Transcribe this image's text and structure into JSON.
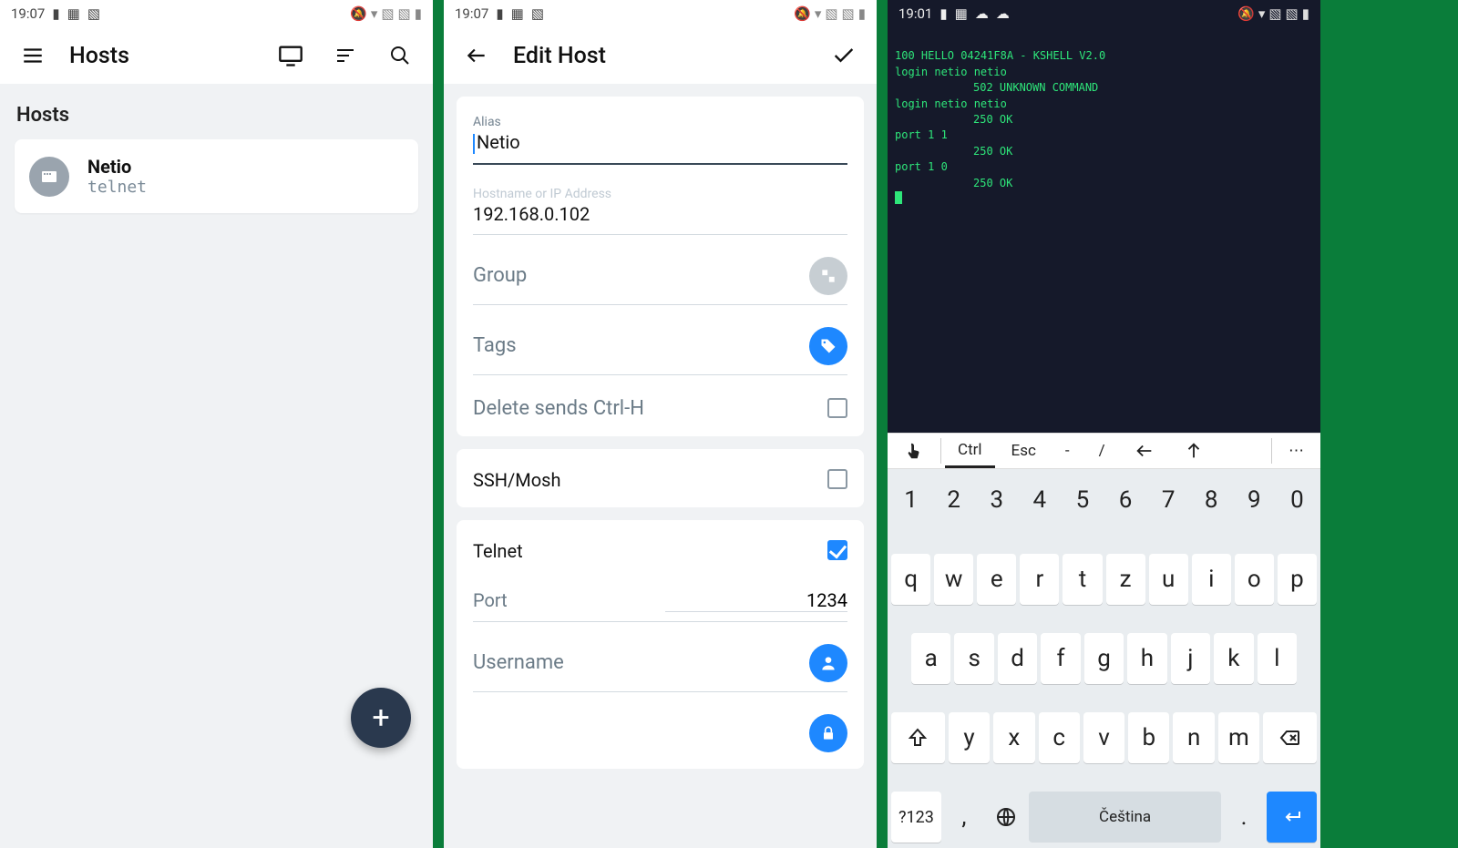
{
  "statusbar": {
    "time1": "19:07",
    "time2": "19:07",
    "time3": "19:01"
  },
  "s1": {
    "title": "Hosts",
    "section": "Hosts",
    "host": {
      "name": "Netio",
      "sub": "telnet"
    }
  },
  "s2": {
    "title": "Edit Host",
    "alias_lbl": "Alias",
    "alias_val": "Netio",
    "host_lbl": "Hostname or IP Address",
    "host_val": "192.168.0.102",
    "group_lbl": "Group",
    "tags_lbl": "Tags",
    "del_lbl": "Delete sends Ctrl-H",
    "ssh_lbl": "SSH/Mosh",
    "telnet_lbl": "Telnet",
    "port_lbl": "Port",
    "port_val": "1234",
    "user_lbl": "Username"
  },
  "s3": {
    "lines": [
      "100 HELLO 04241F8A - KSHELL V2.0",
      "login netio netio",
      "502 UNKNOWN COMMAND",
      "login netio netio",
      "250 OK",
      "port 1 1",
      "250 OK",
      "port 1 0",
      "250 OK"
    ],
    "toolbar": {
      "ctrl": "Ctrl",
      "esc": "Esc",
      "dash": "-",
      "slash": "/",
      "more": "⋯"
    },
    "rows": {
      "num": [
        "1",
        "2",
        "3",
        "4",
        "5",
        "6",
        "7",
        "8",
        "9",
        "0"
      ],
      "r1": [
        "q",
        "w",
        "e",
        "r",
        "t",
        "z",
        "u",
        "i",
        "o",
        "p"
      ],
      "r2": [
        "a",
        "s",
        "d",
        "f",
        "g",
        "h",
        "j",
        "k",
        "l"
      ],
      "r3": [
        "y",
        "x",
        "c",
        "v",
        "b",
        "n",
        "m"
      ],
      "sym": "?123",
      "comma": ",",
      "space": "Čeština",
      "dot": "."
    }
  }
}
